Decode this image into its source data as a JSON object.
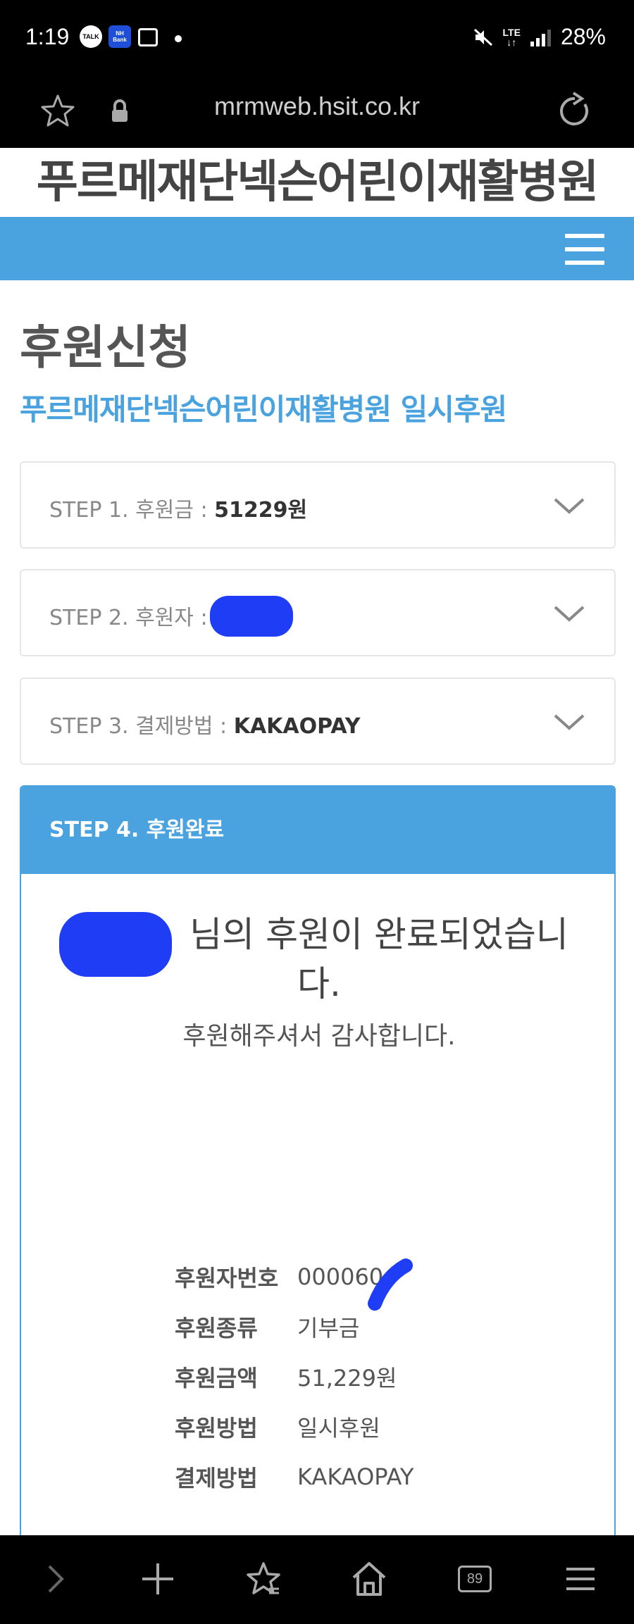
{
  "status_bar": {
    "time": "1:19",
    "notification_icons": [
      "TALK",
      "NH Bank",
      "gallery"
    ],
    "lte": "LTE",
    "battery": "28%"
  },
  "browser": {
    "url": "mrmweb.hsit.co.kr",
    "tab_count": "89"
  },
  "site": {
    "title": "푸르메재단넥슨어린이재활병원",
    "accent_color": "#4aa3df"
  },
  "page": {
    "title": "후원신청",
    "subtitle": "푸르메재단넥슨어린이재활병원 일시후원"
  },
  "steps": [
    {
      "label": "STEP 1. 후원금 : ",
      "value": "51229원"
    },
    {
      "label": "STEP 2. 후원자 : ",
      "value": ""
    },
    {
      "label": "STEP 3. 결제방법 : ",
      "value": "KAKAOPAY"
    }
  ],
  "step4": {
    "title": "STEP 4. 후원완료",
    "message": "님의 후원이 완료되었습니다.",
    "thanks": "후원해주셔서 감사합니다.",
    "details": [
      {
        "label": "후원자번호",
        "value": "000060"
      },
      {
        "label": "후원종류",
        "value": "기부금"
      },
      {
        "label": "후원금액",
        "value": "51,229원"
      },
      {
        "label": "후원방법",
        "value": "일시후원"
      },
      {
        "label": "결제방법",
        "value": "KAKAOPAY"
      }
    ]
  }
}
